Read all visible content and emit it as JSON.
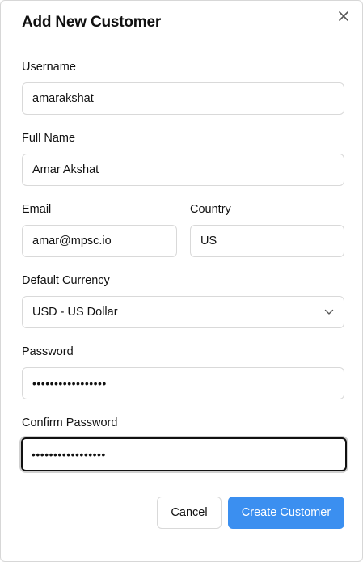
{
  "dialog": {
    "title": "Add New Customer",
    "close_icon": "close-icon"
  },
  "form": {
    "username": {
      "label": "Username",
      "value": "amarakshat"
    },
    "full_name": {
      "label": "Full Name",
      "value": "Amar Akshat"
    },
    "email": {
      "label": "Email",
      "value": "amar@mpsc.io"
    },
    "country": {
      "label": "Country",
      "value": "US"
    },
    "currency": {
      "label": "Default Currency",
      "value": "USD - US Dollar",
      "icon": "chevron-down-icon"
    },
    "password": {
      "label": "Password",
      "masked_value": "•••••••••••••••••"
    },
    "confirm_password": {
      "label": "Confirm Password",
      "masked_value": "•••••••••••••••••"
    }
  },
  "actions": {
    "cancel_label": "Cancel",
    "create_label": "Create Customer"
  },
  "colors": {
    "primary": "#3b8ff0",
    "border": "#d9d9d9",
    "text": "#111111"
  }
}
